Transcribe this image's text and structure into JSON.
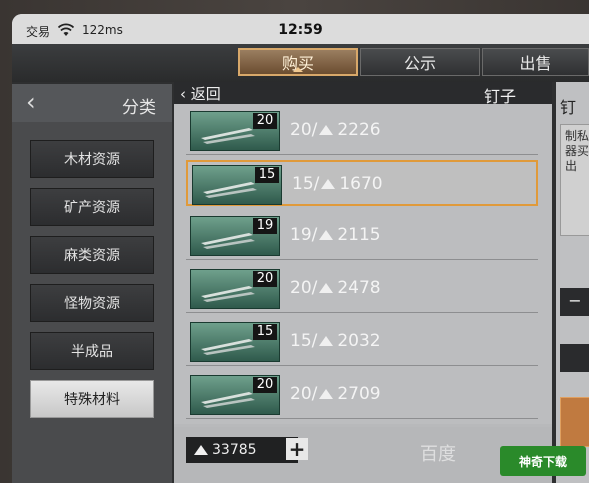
{
  "statusbar": {
    "carrier": "交易",
    "speed": "122ms",
    "time": "12:59"
  },
  "tabs": [
    {
      "label": "购买",
      "active": true
    },
    {
      "label": "公示",
      "active": false
    },
    {
      "label": "出售",
      "active": false
    }
  ],
  "category_panel": {
    "title": "分类",
    "items": [
      {
        "label": "木材资源",
        "active": false
      },
      {
        "label": "矿产资源",
        "active": false
      },
      {
        "label": "麻类资源",
        "active": false
      },
      {
        "label": "怪物资源",
        "active": false
      },
      {
        "label": "半成品",
        "active": false
      },
      {
        "label": "特殊材料",
        "active": true
      }
    ]
  },
  "list_panel": {
    "back_label": "返回",
    "title": "钉子",
    "listings": [
      {
        "quantity": "20",
        "price": "20/",
        "total": "2226",
        "selected": false
      },
      {
        "quantity": "15",
        "price": "15/",
        "total": "1670",
        "selected": true
      },
      {
        "quantity": "19",
        "price": "19/",
        "total": "2115",
        "selected": false
      },
      {
        "quantity": "20",
        "price": "20/",
        "total": "2478",
        "selected": false
      },
      {
        "quantity": "15",
        "price": "15/",
        "total": "2032",
        "selected": false
      },
      {
        "quantity": "20",
        "price": "20/",
        "total": "2709",
        "selected": false
      }
    ],
    "balance": "33785",
    "plus_label": "+"
  },
  "detail_panel": {
    "title": "钉",
    "description": "制私器买出"
  },
  "watermark": {
    "text": "神奇下载",
    "faded": "百度"
  },
  "colors": {
    "accent_tab": "#d8a86a",
    "selected_border": "#e09a3a",
    "thumb_green": "#4f7f6c"
  }
}
